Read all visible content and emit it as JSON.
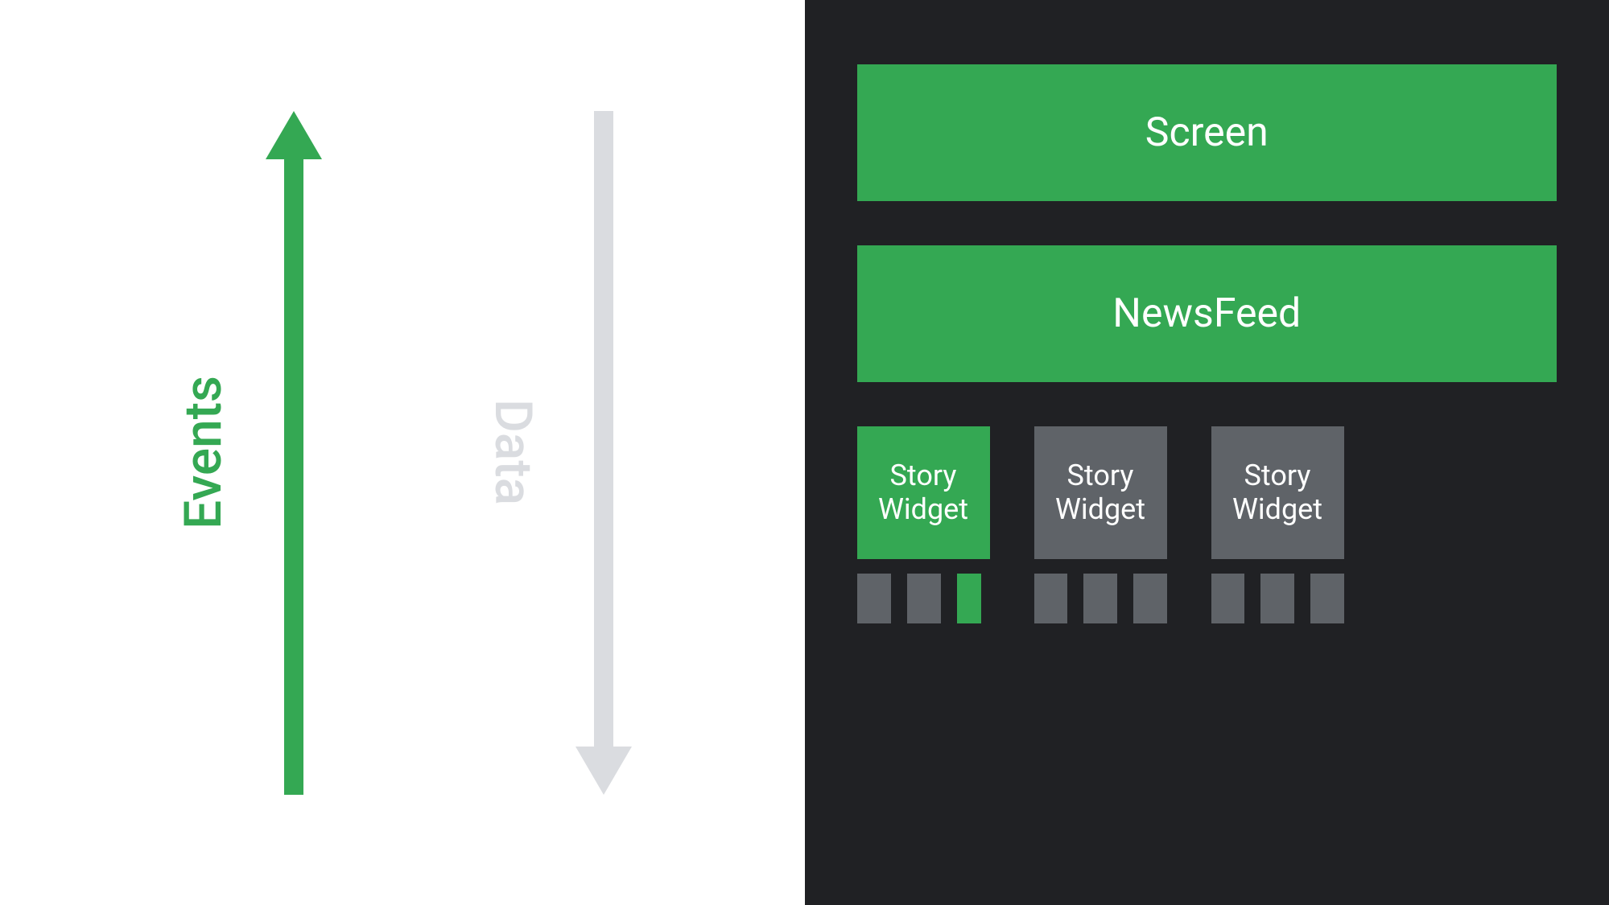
{
  "left": {
    "events_label": "Events",
    "data_label": "Data"
  },
  "right": {
    "block_screen": "Screen",
    "block_newsfeed": "NewsFeed",
    "widgets": [
      {
        "title_line1": "Story",
        "title_line2": "Widget",
        "active": true
      },
      {
        "title_line1": "Story",
        "title_line2": "Widget",
        "active": false
      },
      {
        "title_line1": "Story",
        "title_line2": "Widget",
        "active": false
      }
    ]
  },
  "colors": {
    "green": "#34a853",
    "grey_light": "#dadce0",
    "grey_dark": "#5f6368",
    "dark_bg": "#202124"
  },
  "chart_data": {
    "type": "tree-diagram",
    "title": "Widget hierarchy with Events (up) and Data (down) flow",
    "flows": [
      {
        "name": "Events",
        "direction": "up",
        "color": "#34a853",
        "emphasized": true
      },
      {
        "name": "Data",
        "direction": "down",
        "color": "#dadce0",
        "emphasized": false
      }
    ],
    "hierarchy": {
      "name": "Screen",
      "color": "#34a853",
      "children": [
        {
          "name": "NewsFeed",
          "color": "#34a853",
          "children": [
            {
              "name": "Story Widget",
              "color": "#34a853",
              "active": true,
              "children": [
                {
                  "name": "leaf",
                  "color": "#5f6368"
                },
                {
                  "name": "leaf",
                  "color": "#5f6368"
                },
                {
                  "name": "leaf",
                  "color": "#34a853",
                  "active": true
                }
              ]
            },
            {
              "name": "Story Widget",
              "color": "#5f6368",
              "active": false,
              "children": [
                {
                  "name": "leaf",
                  "color": "#5f6368"
                },
                {
                  "name": "leaf",
                  "color": "#5f6368"
                },
                {
                  "name": "leaf",
                  "color": "#5f6368"
                }
              ]
            },
            {
              "name": "Story Widget",
              "color": "#5f6368",
              "active": false,
              "children": [
                {
                  "name": "leaf",
                  "color": "#5f6368"
                },
                {
                  "name": "leaf",
                  "color": "#5f6368"
                },
                {
                  "name": "leaf",
                  "color": "#5f6368"
                }
              ]
            }
          ]
        }
      ]
    }
  }
}
